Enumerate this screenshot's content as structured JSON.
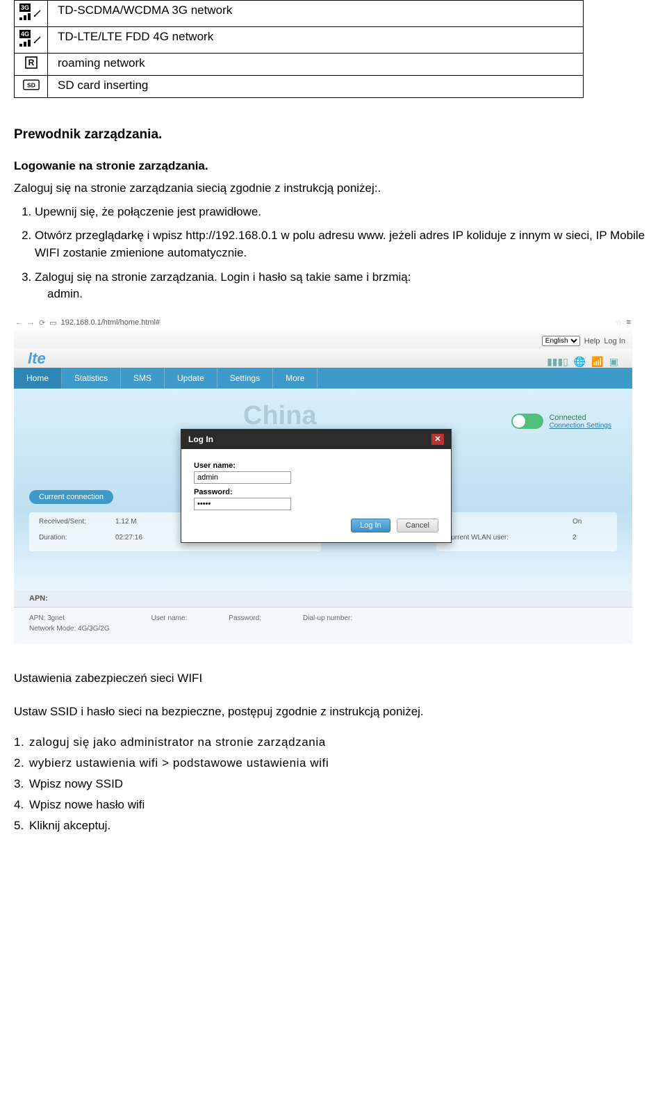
{
  "defs": {
    "row1": "TD-SCDMA/WCDMA 3G network",
    "row2": "TD-LTE/LTE FDD 4G network",
    "row3": "roaming network",
    "row4": "SD card inserting"
  },
  "section1": {
    "title": "Prewodnik zarządzania.",
    "subtitle": "Logowanie na stronie zarządzania.",
    "intro": "Zaloguj się na stronie zarządzania siecią zgodnie z instrukcją poniżej:.",
    "step1": "Upewnij się, że połączenie jest prawidłowe.",
    "step2": "Otwórz przeglądarkę i wpisz  http://192.168.0.1  w polu adresu www. jeżeli adres IP koliduje z innym w sieci, IP Mobile WIFI zostanie zmienione automatycznie.",
    "step3_a": "Zaloguj się na stronie zarządzania. Login i hasło są takie same i brzmią:",
    "step3_b": "admin."
  },
  "shot": {
    "url": "192.168.0.1/html/home.html#",
    "lang_selected": "English",
    "help": "Help",
    "login_link": "Log In",
    "logo": "lte",
    "nav": [
      "Home",
      "Statistics",
      "SMS",
      "Update",
      "Settings",
      "More"
    ],
    "watermark": "China",
    "connected": "Connected",
    "conn_settings": "Connection Settings",
    "login": {
      "title": "Log In",
      "user_label": "User name:",
      "user_value": "admin",
      "pass_label": "Password:",
      "pass_value": "•••••",
      "login_btn": "Log In",
      "cancel_btn": "Cancel"
    },
    "pill": "Current connection",
    "stats": {
      "k1": "Received/Sent:",
      "v1": "1.12 M",
      "k2": "Duration:",
      "v2": "02:27:16"
    },
    "wlan_label": "Current WLAN user:",
    "wlan_on_k": "",
    "wlan_on_v": "On",
    "wlan_users_v": "2",
    "apn_header": "APN:",
    "apn": {
      "apn_label": "APN: 3gnet",
      "mode_label": "Network Mode: 4G/3G/2G",
      "user_label": "User name:",
      "pass_label": "Password:",
      "dial_label": "Dial-up number:"
    }
  },
  "section2": {
    "title": "Ustawienia zabezpieczeń sieci WIFI",
    "intro": "Ustaw SSID i hasło sieci na bezpieczne, postępuj zgodnie z instrukcją poniżej.",
    "s1": "zaloguj się jako administrator na stronie zarządzania",
    "s2": "wybierz ustawienia wifi > podstawowe ustawienia wifi",
    "s3": "Wpisz nowy SSID",
    "s4": "Wpisz nowe hasło wifi",
    "s5": "Kliknij akceptuj."
  }
}
